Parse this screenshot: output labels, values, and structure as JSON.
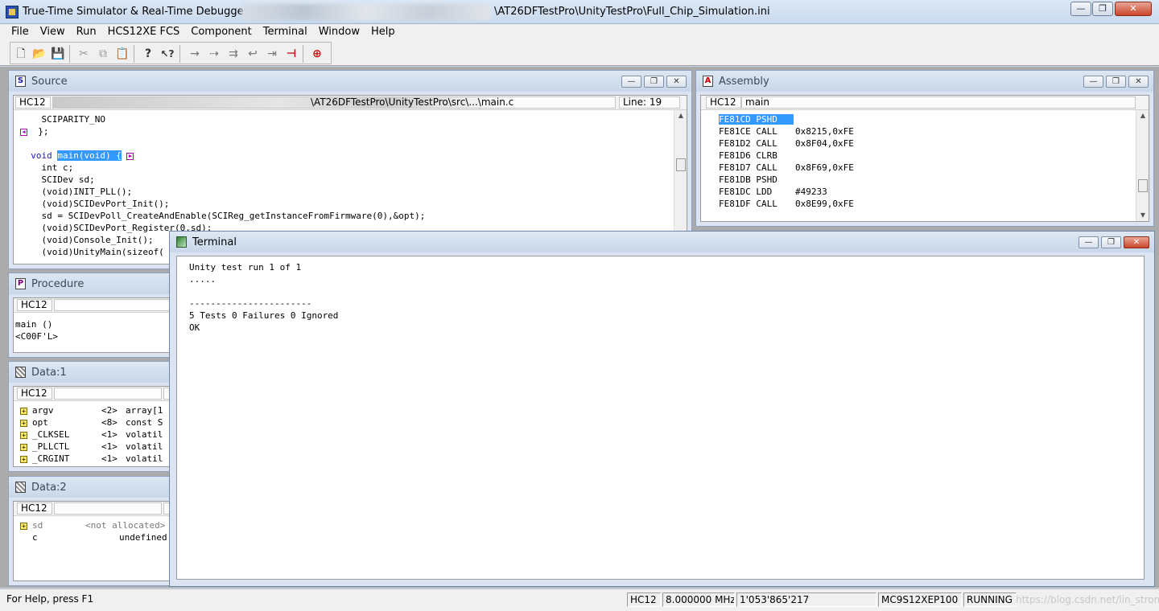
{
  "app": {
    "title": "True-Time Simulator & Real-Time Debugger",
    "title_path": "\\AT26DFTestPro\\UnityTestPro\\Full_Chip_Simulation.ini",
    "min_glyph": "▭",
    "max_glyph": "❐",
    "close_glyph": "✕"
  },
  "menu": [
    "File",
    "View",
    "Run",
    "HCS12XE FCS",
    "Component",
    "Terminal",
    "Window",
    "Help"
  ],
  "toolbar_icons": [
    "new-file-icon",
    "open-folder-icon",
    "save-icon",
    "cut-icon",
    "copy-icon",
    "paste-icon",
    "help-icon",
    "context-help-icon",
    "start-icon",
    "single-step-icon",
    "step-over-icon",
    "step-out-icon",
    "assembly-step-icon",
    "halt-icon",
    "reset-icon"
  ],
  "toolbar_glyphs": [
    "🗋",
    "📂",
    "💾",
    "✂",
    "⧉",
    "📋",
    "?",
    "↖?",
    "→",
    "⇢",
    "⇉",
    "↩",
    "⇥",
    "⊣",
    "⊕"
  ],
  "window_buttons": {
    "min": "—",
    "restore": "❐",
    "close": "✕"
  },
  "source": {
    "title": "Source",
    "icon_letter": "S",
    "cpu": "HC12",
    "path": "\\AT26DFTestPro\\UnityTestPro\\src\\...\\main.c",
    "line_info": "Line: 19",
    "lines": [
      "    SCIPARITY_NO",
      "  };",
      "",
      "  void main(void) {",
      "    int c;",
      "    SCIDev sd;",
      "    (void)INIT_PLL();",
      "    (void)SCIDevPort_Init();",
      "    sd = SCIDevPoll_CreateAndEnable(SCIReg_getInstanceFromFirmware(0),&opt);",
      "    (void)SCIDevPort_Register(0,sd);",
      "    (void)Console_Init();",
      "    (void)UnityMain(sizeof("
    ]
  },
  "assembly": {
    "title": "Assembly",
    "icon_letter": "A",
    "cpu": "HC12",
    "func": "main",
    "lines": [
      {
        "addr": "FE81CD",
        "op": "PSHD",
        "arg": ""
      },
      {
        "addr": "FE81CE",
        "op": "CALL",
        "arg": "0x8215,0xFE"
      },
      {
        "addr": "FE81D2",
        "op": "CALL",
        "arg": "0x8F04,0xFE"
      },
      {
        "addr": "FE81D6",
        "op": "CLRB",
        "arg": ""
      },
      {
        "addr": "FE81D7",
        "op": "CALL",
        "arg": "0x8F69,0xFE"
      },
      {
        "addr": "FE81DB",
        "op": "PSHD",
        "arg": ""
      },
      {
        "addr": "FE81DC",
        "op": "LDD",
        "arg": "#49233"
      },
      {
        "addr": "FE81DF",
        "op": "CALL",
        "arg": "0x8E99,0xFE"
      }
    ]
  },
  "procedure": {
    "title": "Procedure",
    "icon_letter": "P",
    "cpu": "HC12",
    "lines": [
      "main ()",
      "<C00F'L>"
    ]
  },
  "data1": {
    "title": "Data:1",
    "cpu": "HC12",
    "rows": [
      {
        "name": "argv",
        "size": "<2>",
        "type": "array[1"
      },
      {
        "name": "opt",
        "size": "<8>",
        "type": "const S"
      },
      {
        "name": "_CLKSEL",
        "size": "<1>",
        "type": "volatil"
      },
      {
        "name": "_PLLCTL",
        "size": "<1>",
        "type": "volatil"
      },
      {
        "name": "_CRGINT",
        "size": "<1>",
        "type": "volatil"
      }
    ]
  },
  "data2": {
    "title": "Data:2",
    "cpu": "HC12",
    "rows": [
      {
        "name": "sd",
        "value": "<not allocated>"
      },
      {
        "name": "c",
        "value": "undefined"
      }
    ]
  },
  "terminal": {
    "title": "Terminal",
    "lines": [
      "Unity test run 1 of 1",
      ".....",
      "",
      "-----------------------",
      "5 Tests 0 Failures 0 Ignored",
      "OK"
    ]
  },
  "status": {
    "help": "For Help, press F1",
    "cpu": "HC12",
    "freq": "8.000000 MHz",
    "cycles": "1'053'865'217",
    "chip": "MC9S12XEP100",
    "state": "RUNNING",
    "watermark": "https://blog.csdn.net/lin_strong"
  },
  "colors": {
    "accent": "#3399ff",
    "title_bg": "#c9daee",
    "mdi_bg": "#ababab"
  }
}
